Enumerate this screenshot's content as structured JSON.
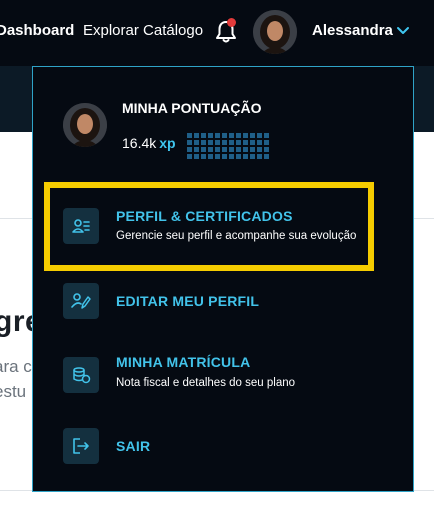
{
  "header": {
    "nav_dashboard": "Dashboard",
    "nav_catalog": "Explorar Catálogo",
    "user_name": "Alessandra"
  },
  "background": {
    "heading_fragment": "gre",
    "text_line_1": "ara c",
    "text_line_2": "estu"
  },
  "menu": {
    "score_title": "MINHA PONTUAÇÃO",
    "xp_value": "16.4k",
    "xp_unit": "xp",
    "items": [
      {
        "title": "PERFIL & CERTIFICADOS",
        "description": "Gerencie seu perfil e acompanhe sua evolução",
        "icon": "profile-card-icon",
        "highlighted": true
      },
      {
        "title": "EDITAR MEU PERFIL",
        "description": "",
        "icon": "edit-profile-icon",
        "highlighted": false
      },
      {
        "title": "MINHA MATRÍCULA",
        "description": "Nota fiscal e detalhes do seu plano",
        "icon": "coins-icon",
        "highlighted": false
      },
      {
        "title": "SAIR",
        "description": "",
        "icon": "logout-icon",
        "highlighted": false
      }
    ]
  },
  "colors": {
    "accent": "#42c3ea",
    "highlight": "#f5cc00",
    "menu_bg": "#050a12",
    "notification": "#e23a3a"
  }
}
